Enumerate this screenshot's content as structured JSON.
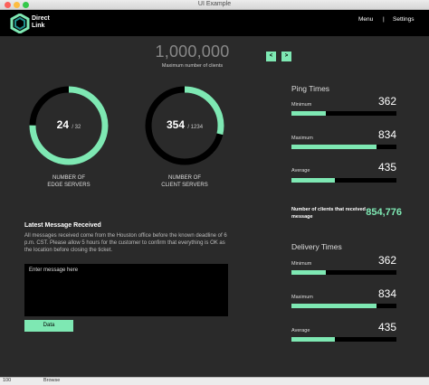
{
  "window": {
    "title": "UI Example"
  },
  "header": {
    "logo_line1": "Direct",
    "logo_line2": "Link",
    "menu_label": "Menu",
    "separator": "|",
    "settings_label": "Settings"
  },
  "summary": {
    "max_clients": "1,000,000",
    "max_clients_label": "Maximum number of clients",
    "prev_label": "<",
    "next_label": ">"
  },
  "gauges": [
    {
      "value": "24",
      "total": "/ 32",
      "fraction": 0.75,
      "label_line1": "NUMBER OF",
      "label_line2": "EDGE SERVERS"
    },
    {
      "value": "354",
      "total": "/ 1234",
      "fraction": 0.287,
      "label_line1": "NUMBER OF",
      "label_line2": "CLIENT SERVERS"
    }
  ],
  "message": {
    "title": "Latest Message Received",
    "body": "All messages received come from the Houston office before the known deadline of 6 p.m. CST. Please allow 5 hours for the customer to confirm that everything is OK as the location before closing the ticket.",
    "input_placeholder": "Enter message here",
    "button_label": "Data"
  },
  "ping_times": {
    "title": "Ping Times",
    "items": [
      {
        "label": "Minimum",
        "value": "362",
        "fraction": 0.33
      },
      {
        "label": "Maximum",
        "value": "834",
        "fraction": 0.81
      },
      {
        "label": "Average",
        "value": "435",
        "fraction": 0.41
      }
    ]
  },
  "clients": {
    "label": "Number of clients that received message",
    "value": "854,776"
  },
  "delivery_times": {
    "title": "Delivery Times",
    "items": [
      {
        "label": "Minimum",
        "value": "362",
        "fraction": 0.33
      },
      {
        "label": "Maximum",
        "value": "834",
        "fraction": 0.81
      },
      {
        "label": "Average",
        "value": "435",
        "fraction": 0.41
      }
    ]
  },
  "statusbar": {
    "zoom": "100",
    "browse": "Browse"
  },
  "colors": {
    "accent": "#7ee8b3",
    "background": "#2a2a2a",
    "topbar": "#000000",
    "ring_track": "#000000"
  }
}
